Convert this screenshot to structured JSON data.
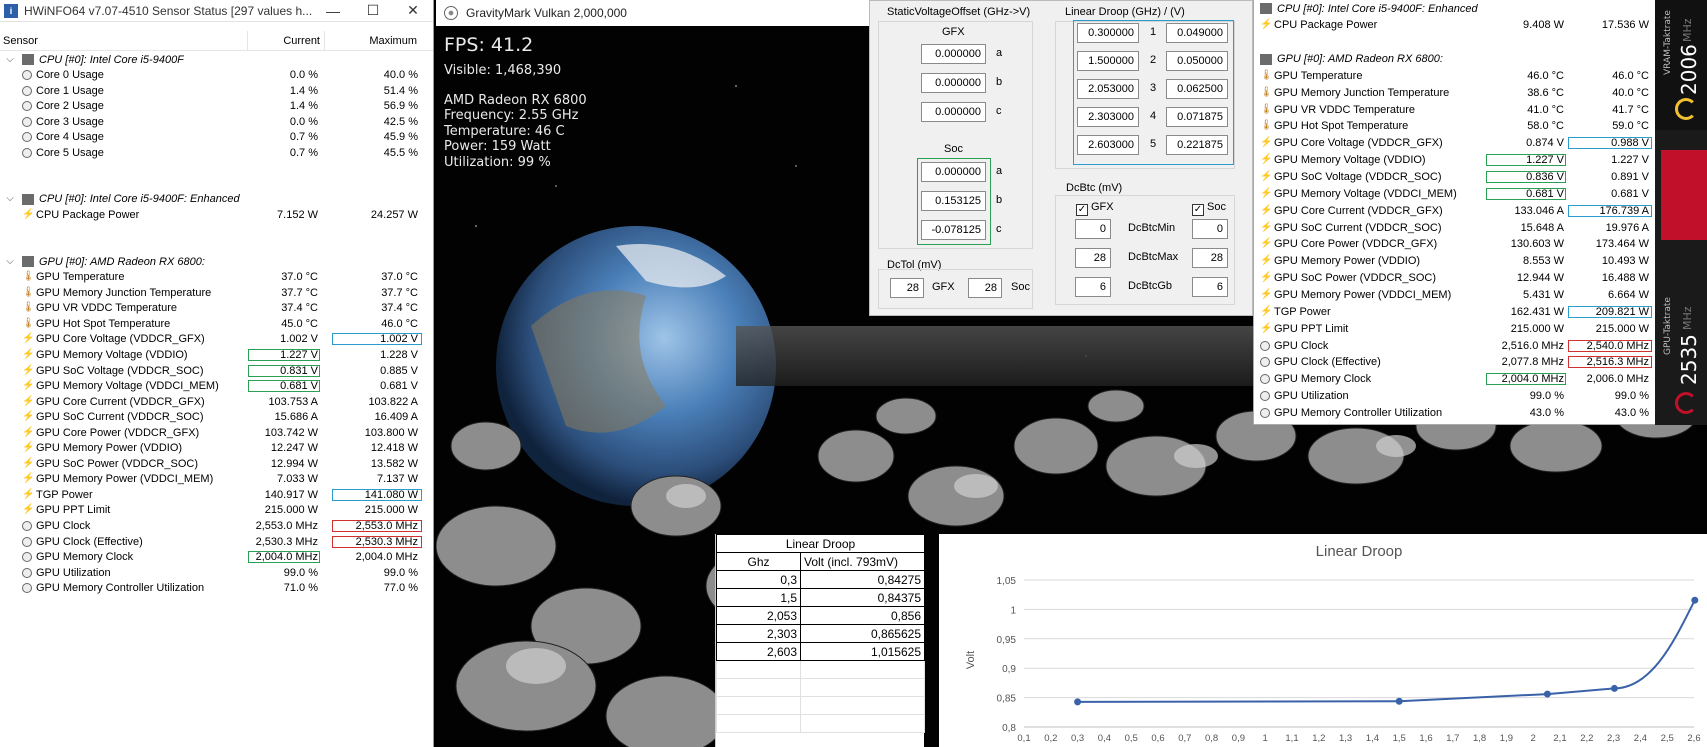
{
  "hwinfo": {
    "title": "HWiNFO64 v7.07-4510 Sensor Status [297 values h...",
    "window_buttons": [
      "—",
      "☐",
      "✕"
    ],
    "columns": [
      "Sensor",
      "Current",
      "Maximum"
    ],
    "groups": [
      {
        "title": "CPU [#0]: Intel Core i5-9400F",
        "rows": [
          {
            "name": "Core 0 Usage",
            "icon": "circle",
            "current": "0.0 %",
            "max": "40.0 %"
          },
          {
            "name": "Core 1 Usage",
            "icon": "circle",
            "current": "1.4 %",
            "max": "51.4 %"
          },
          {
            "name": "Core 2 Usage",
            "icon": "circle",
            "current": "1.4 %",
            "max": "56.9 %"
          },
          {
            "name": "Core 3 Usage",
            "icon": "circle",
            "current": "0.0 %",
            "max": "42.5 %"
          },
          {
            "name": "Core 4 Usage",
            "icon": "circle",
            "current": "0.7 %",
            "max": "45.9 %"
          },
          {
            "name": "Core 5 Usage",
            "icon": "circle",
            "current": "0.7 %",
            "max": "45.5 %"
          }
        ]
      },
      {
        "title": "CPU [#0]: Intel Core i5-9400F: Enhanced",
        "rows": [
          {
            "name": "CPU Package Power",
            "icon": "bolt",
            "current": "7.152 W",
            "max": "24.257 W"
          }
        ]
      },
      {
        "title": "GPU [#0]: AMD Radeon RX 6800:",
        "rows": [
          {
            "name": "GPU Temperature",
            "icon": "therm",
            "current": "37.0 °C",
            "max": "37.0 °C"
          },
          {
            "name": "GPU Memory Junction Temperature",
            "icon": "therm",
            "current": "37.7 °C",
            "max": "37.7 °C"
          },
          {
            "name": "GPU VR VDDC Temperature",
            "icon": "therm",
            "current": "37.4 °C",
            "max": "37.4 °C"
          },
          {
            "name": "GPU Hot Spot Temperature",
            "icon": "therm",
            "current": "45.0 °C",
            "max": "46.0 °C"
          },
          {
            "name": "GPU Core Voltage (VDDCR_GFX)",
            "icon": "bolt",
            "current": "1.002 V",
            "max": "1.002 V",
            "mbox": "blue"
          },
          {
            "name": "GPU Memory Voltage (VDDIO)",
            "icon": "bolt",
            "current": "1.227 V",
            "max": "1.228 V",
            "cbox": "green"
          },
          {
            "name": "GPU SoC Voltage (VDDCR_SOC)",
            "icon": "bolt",
            "current": "0.831 V",
            "max": "0.885 V",
            "cbox": "green"
          },
          {
            "name": "GPU Memory Voltage (VDDCI_MEM)",
            "icon": "bolt",
            "current": "0.681 V",
            "max": "0.681 V",
            "cbox": "green"
          },
          {
            "name": "GPU Core Current (VDDCR_GFX)",
            "icon": "bolt",
            "current": "103.753 A",
            "max": "103.822 A"
          },
          {
            "name": "GPU SoC Current (VDDCR_SOC)",
            "icon": "bolt",
            "current": "15.686 A",
            "max": "16.409 A"
          },
          {
            "name": "GPU Core Power (VDDCR_GFX)",
            "icon": "bolt",
            "current": "103.742 W",
            "max": "103.800 W"
          },
          {
            "name": "GPU Memory Power (VDDIO)",
            "icon": "bolt",
            "current": "12.247 W",
            "max": "12.418 W"
          },
          {
            "name": "GPU SoC Power (VDDCR_SOC)",
            "icon": "bolt",
            "current": "12.994 W",
            "max": "13.582 W"
          },
          {
            "name": "GPU Memory Power (VDDCI_MEM)",
            "icon": "bolt",
            "current": "7.033 W",
            "max": "7.137 W"
          },
          {
            "name": "TGP Power",
            "icon": "bolt",
            "current": "140.917 W",
            "max": "141.080 W",
            "mbox": "blue"
          },
          {
            "name": "GPU PPT Limit",
            "icon": "bolt",
            "current": "215.000 W",
            "max": "215.000 W"
          },
          {
            "name": "GPU Clock",
            "icon": "circle",
            "current": "2,553.0 MHz",
            "max": "2,553.0 MHz",
            "mbox": "red"
          },
          {
            "name": "GPU Clock (Effective)",
            "icon": "circle",
            "current": "2,530.3 MHz",
            "max": "2,530.3 MHz",
            "mbox": "red"
          },
          {
            "name": "GPU Memory Clock",
            "icon": "circle",
            "current": "2,004.0 MHz",
            "max": "2,004.0 MHz",
            "cbox": "green"
          },
          {
            "name": "GPU Utilization",
            "icon": "circle",
            "current": "99.0 %",
            "max": "99.0 %"
          },
          {
            "name": "GPU Memory Controller Utilization",
            "icon": "circle",
            "current": "71.0 %",
            "max": "77.0 %"
          }
        ]
      }
    ]
  },
  "gravitymark": {
    "title": "GravityMark Vulkan 2,000,000",
    "fps": "FPS: 41.2",
    "visible": "Visible: 1,468,390",
    "gpu": "AMD Radeon RX 6800",
    "frequency": "Frequency: 2.55 GHz",
    "temperature": "Temperature: 46 C",
    "power": "Power: 159 Watt",
    "utilization": "Utilization: 99 %"
  },
  "tuner": {
    "svo_title": "StaticVoltageOffset (GHz->V)",
    "gfx_label": "GFX",
    "soc_label": "Soc",
    "svo_gfx": [
      {
        "value": "0.000000",
        "label": "a"
      },
      {
        "value": "0.000000",
        "label": "b"
      },
      {
        "value": "0.000000",
        "label": "c"
      }
    ],
    "svo_soc": [
      {
        "value": "0.000000",
        "label": "a"
      },
      {
        "value": "0.153125",
        "label": "b"
      },
      {
        "value": "-0.078125",
        "label": "c"
      }
    ],
    "ld_title": "Linear Droop (GHz) / (V)",
    "ld_rows": [
      {
        "ghz": "0.300000",
        "idx": "1",
        "v": "0.049000"
      },
      {
        "ghz": "1.500000",
        "idx": "2",
        "v": "0.050000"
      },
      {
        "ghz": "2.053000",
        "idx": "3",
        "v": "0.062500"
      },
      {
        "ghz": "2.303000",
        "idx": "4",
        "v": "0.071875"
      },
      {
        "ghz": "2.603000",
        "idx": "5",
        "v": "0.221875"
      }
    ],
    "dcbtc_title": "DcBtc (mV)",
    "dcbtc_gfx": "GFX",
    "dcbtc_soc": "Soc",
    "dcbtc_rows": [
      {
        "label": "DcBtcMin",
        "gfx": "0",
        "soc": "0"
      },
      {
        "label": "DcBtcMax",
        "gfx": "28",
        "soc": "28"
      },
      {
        "label": "DcBtcGb",
        "gfx": "6",
        "soc": "6"
      }
    ],
    "dctol_title": "DcTol (mV)",
    "dctol_gfx": "28",
    "dctol_gfx_label": "GFX",
    "dctol_soc": "28",
    "dctol_soc_label": "Soc"
  },
  "hwinfo2": {
    "groups": [
      {
        "title": "CPU [#0]: Intel Core i5-9400F: Enhanced",
        "rows": [
          {
            "name": "CPU Package Power",
            "icon": "bolt",
            "current": "9.408 W",
            "max": "17.536 W"
          }
        ]
      },
      {
        "title": "GPU [#0]: AMD Radeon RX 6800:",
        "rows": [
          {
            "name": "GPU Temperature",
            "icon": "therm",
            "current": "46.0 °C",
            "max": "46.0 °C"
          },
          {
            "name": "GPU Memory Junction Temperature",
            "icon": "therm",
            "current": "38.6 °C",
            "max": "40.0 °C"
          },
          {
            "name": "GPU VR VDDC Temperature",
            "icon": "therm",
            "current": "41.0 °C",
            "max": "41.7 °C"
          },
          {
            "name": "GPU Hot Spot Temperature",
            "icon": "therm",
            "current": "58.0 °C",
            "max": "59.0 °C"
          },
          {
            "name": "GPU Core Voltage (VDDCR_GFX)",
            "icon": "bolt",
            "current": "0.874 V",
            "max": "0.988 V",
            "mbox": "blue"
          },
          {
            "name": "GPU Memory Voltage (VDDIO)",
            "icon": "bolt",
            "current": "1.227 V",
            "max": "1.227 V",
            "cbox": "green"
          },
          {
            "name": "GPU SoC Voltage (VDDCR_SOC)",
            "icon": "bolt",
            "current": "0.836 V",
            "max": "0.891 V",
            "cbox": "green"
          },
          {
            "name": "GPU Memory Voltage (VDDCI_MEM)",
            "icon": "bolt",
            "current": "0.681 V",
            "max": "0.681 V",
            "cbox": "green"
          },
          {
            "name": "GPU Core Current (VDDCR_GFX)",
            "icon": "bolt",
            "current": "133.046 A",
            "max": "176.739 A",
            "mbox": "blue"
          },
          {
            "name": "GPU SoC Current (VDDCR_SOC)",
            "icon": "bolt",
            "current": "15.648 A",
            "max": "19.976 A"
          },
          {
            "name": "GPU Core Power (VDDCR_GFX)",
            "icon": "bolt",
            "current": "130.603 W",
            "max": "173.464 W"
          },
          {
            "name": "GPU Memory Power (VDDIO)",
            "icon": "bolt",
            "current": "8.553 W",
            "max": "10.493 W"
          },
          {
            "name": "GPU SoC Power (VDDCR_SOC)",
            "icon": "bolt",
            "current": "12.944 W",
            "max": "16.488 W"
          },
          {
            "name": "GPU Memory Power (VDDCI_MEM)",
            "icon": "bolt",
            "current": "5.431 W",
            "max": "6.664 W"
          },
          {
            "name": "TGP Power",
            "icon": "bolt",
            "current": "162.431 W",
            "max": "209.821 W",
            "mbox": "blue"
          },
          {
            "name": "GPU PPT Limit",
            "icon": "bolt",
            "current": "215.000 W",
            "max": "215.000 W"
          },
          {
            "name": "GPU Clock",
            "icon": "circle",
            "current": "2,516.0 MHz",
            "max": "2,540.0 MHz",
            "mbox": "red"
          },
          {
            "name": "GPU Clock (Effective)",
            "icon": "circle",
            "current": "2,077.8 MHz",
            "max": "2,516.3 MHz",
            "mbox": "red"
          },
          {
            "name": "GPU Memory Clock",
            "icon": "circle",
            "current": "2,004.0 MHz",
            "max": "2,006.0 MHz",
            "cbox": "green"
          },
          {
            "name": "GPU Utilization",
            "icon": "circle",
            "current": "99.0 %",
            "max": "99.0 %"
          },
          {
            "name": "GPU Memory Controller Utilization",
            "icon": "circle",
            "current": "43.0 %",
            "max": "43.0 %"
          }
        ]
      }
    ]
  },
  "gauges": {
    "vram_label": "VRAM-Taktrate",
    "vram_value": "2006",
    "vram_unit": "MHz",
    "gpu_label": "GPU-Taktrate",
    "gpu_value": "2535",
    "gpu_unit": "MHz",
    "accent": "#c0102a",
    "ring": "#f2c12e"
  },
  "table": {
    "title": "Linear Droop",
    "col1": "Ghz",
    "col2": "Volt (incl. 793mV)",
    "rows": [
      {
        "ghz": "0,3",
        "volt": "0,84275"
      },
      {
        "ghz": "1,5",
        "volt": "0,84375"
      },
      {
        "ghz": "2,053",
        "volt": "0,856"
      },
      {
        "ghz": "2,303",
        "volt": "0,865625"
      },
      {
        "ghz": "2,603",
        "volt": "1,015625"
      }
    ]
  },
  "chart_data": {
    "type": "line",
    "title": "Linear Droop",
    "ylabel": "Volt",
    "xlabel": "",
    "x": [
      0.3,
      1.5,
      2.053,
      2.303,
      2.603
    ],
    "y": [
      0.84275,
      0.84375,
      0.856,
      0.865625,
      1.015625
    ],
    "xlim": [
      0.1,
      2.6
    ],
    "ylim": [
      0.8,
      1.05
    ],
    "x_ticks": [
      "0,1",
      "0,2",
      "0,3",
      "0,4",
      "0,5",
      "0,6",
      "0,7",
      "0,8",
      "0,9",
      "1",
      "1,1",
      "1,2",
      "1,3",
      "1,4",
      "1,5",
      "1,6",
      "1,7",
      "1,8",
      "1,9",
      "2",
      "2,1",
      "2,2",
      "2,3",
      "2,4",
      "2,5",
      "2,6"
    ],
    "y_ticks": [
      "0,8",
      "0,85",
      "0,9",
      "0,95",
      "1",
      "1,05"
    ],
    "series_color": "#3a62a8",
    "grid": "horizontal"
  }
}
